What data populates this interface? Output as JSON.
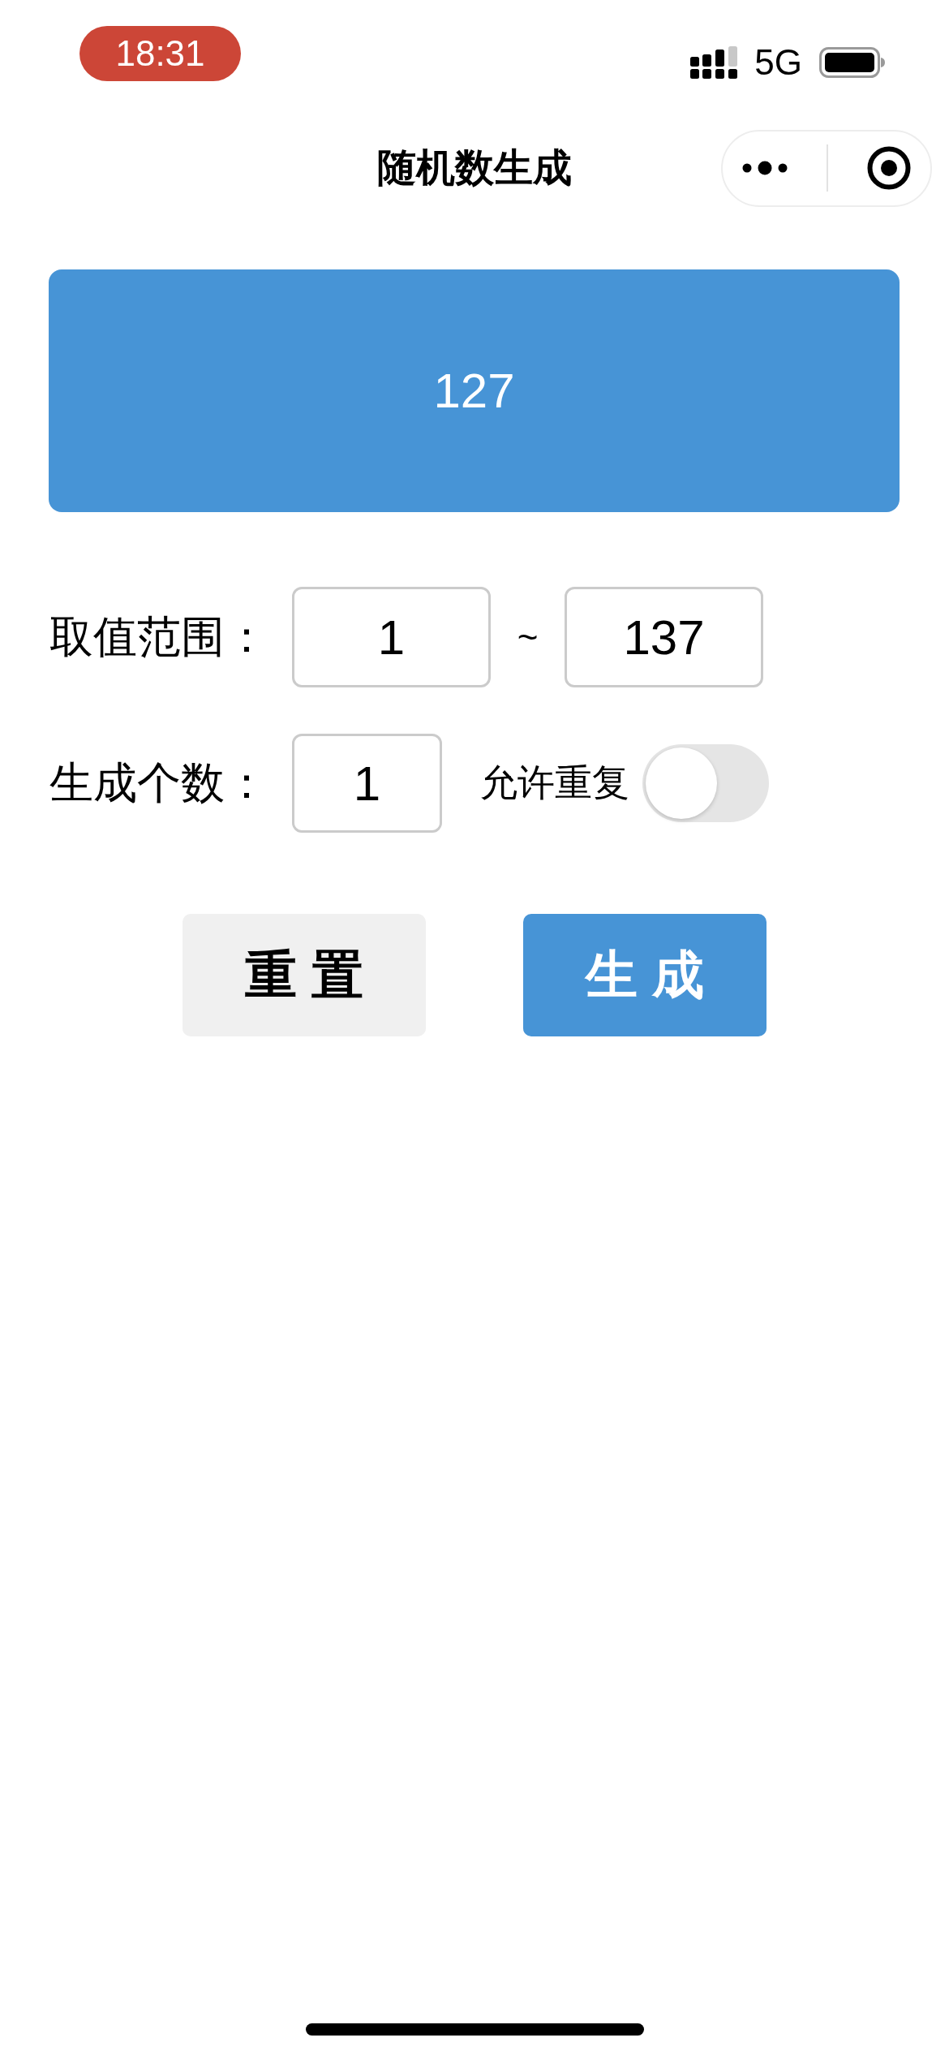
{
  "status_bar": {
    "time": "18:31",
    "network": "5G"
  },
  "nav_bar": {
    "title": "随机数生成"
  },
  "result": {
    "value": "127"
  },
  "range": {
    "label": "取值范围：",
    "min": "1",
    "separator": "~",
    "max": "137"
  },
  "count": {
    "label": "生成个数：",
    "value": "1",
    "allow_repeat": {
      "label": "允许重复",
      "on": false
    }
  },
  "buttons": [
    {
      "label": "重 置",
      "kind": "secondary"
    },
    {
      "label": "生 成",
      "kind": "primary"
    }
  ]
}
